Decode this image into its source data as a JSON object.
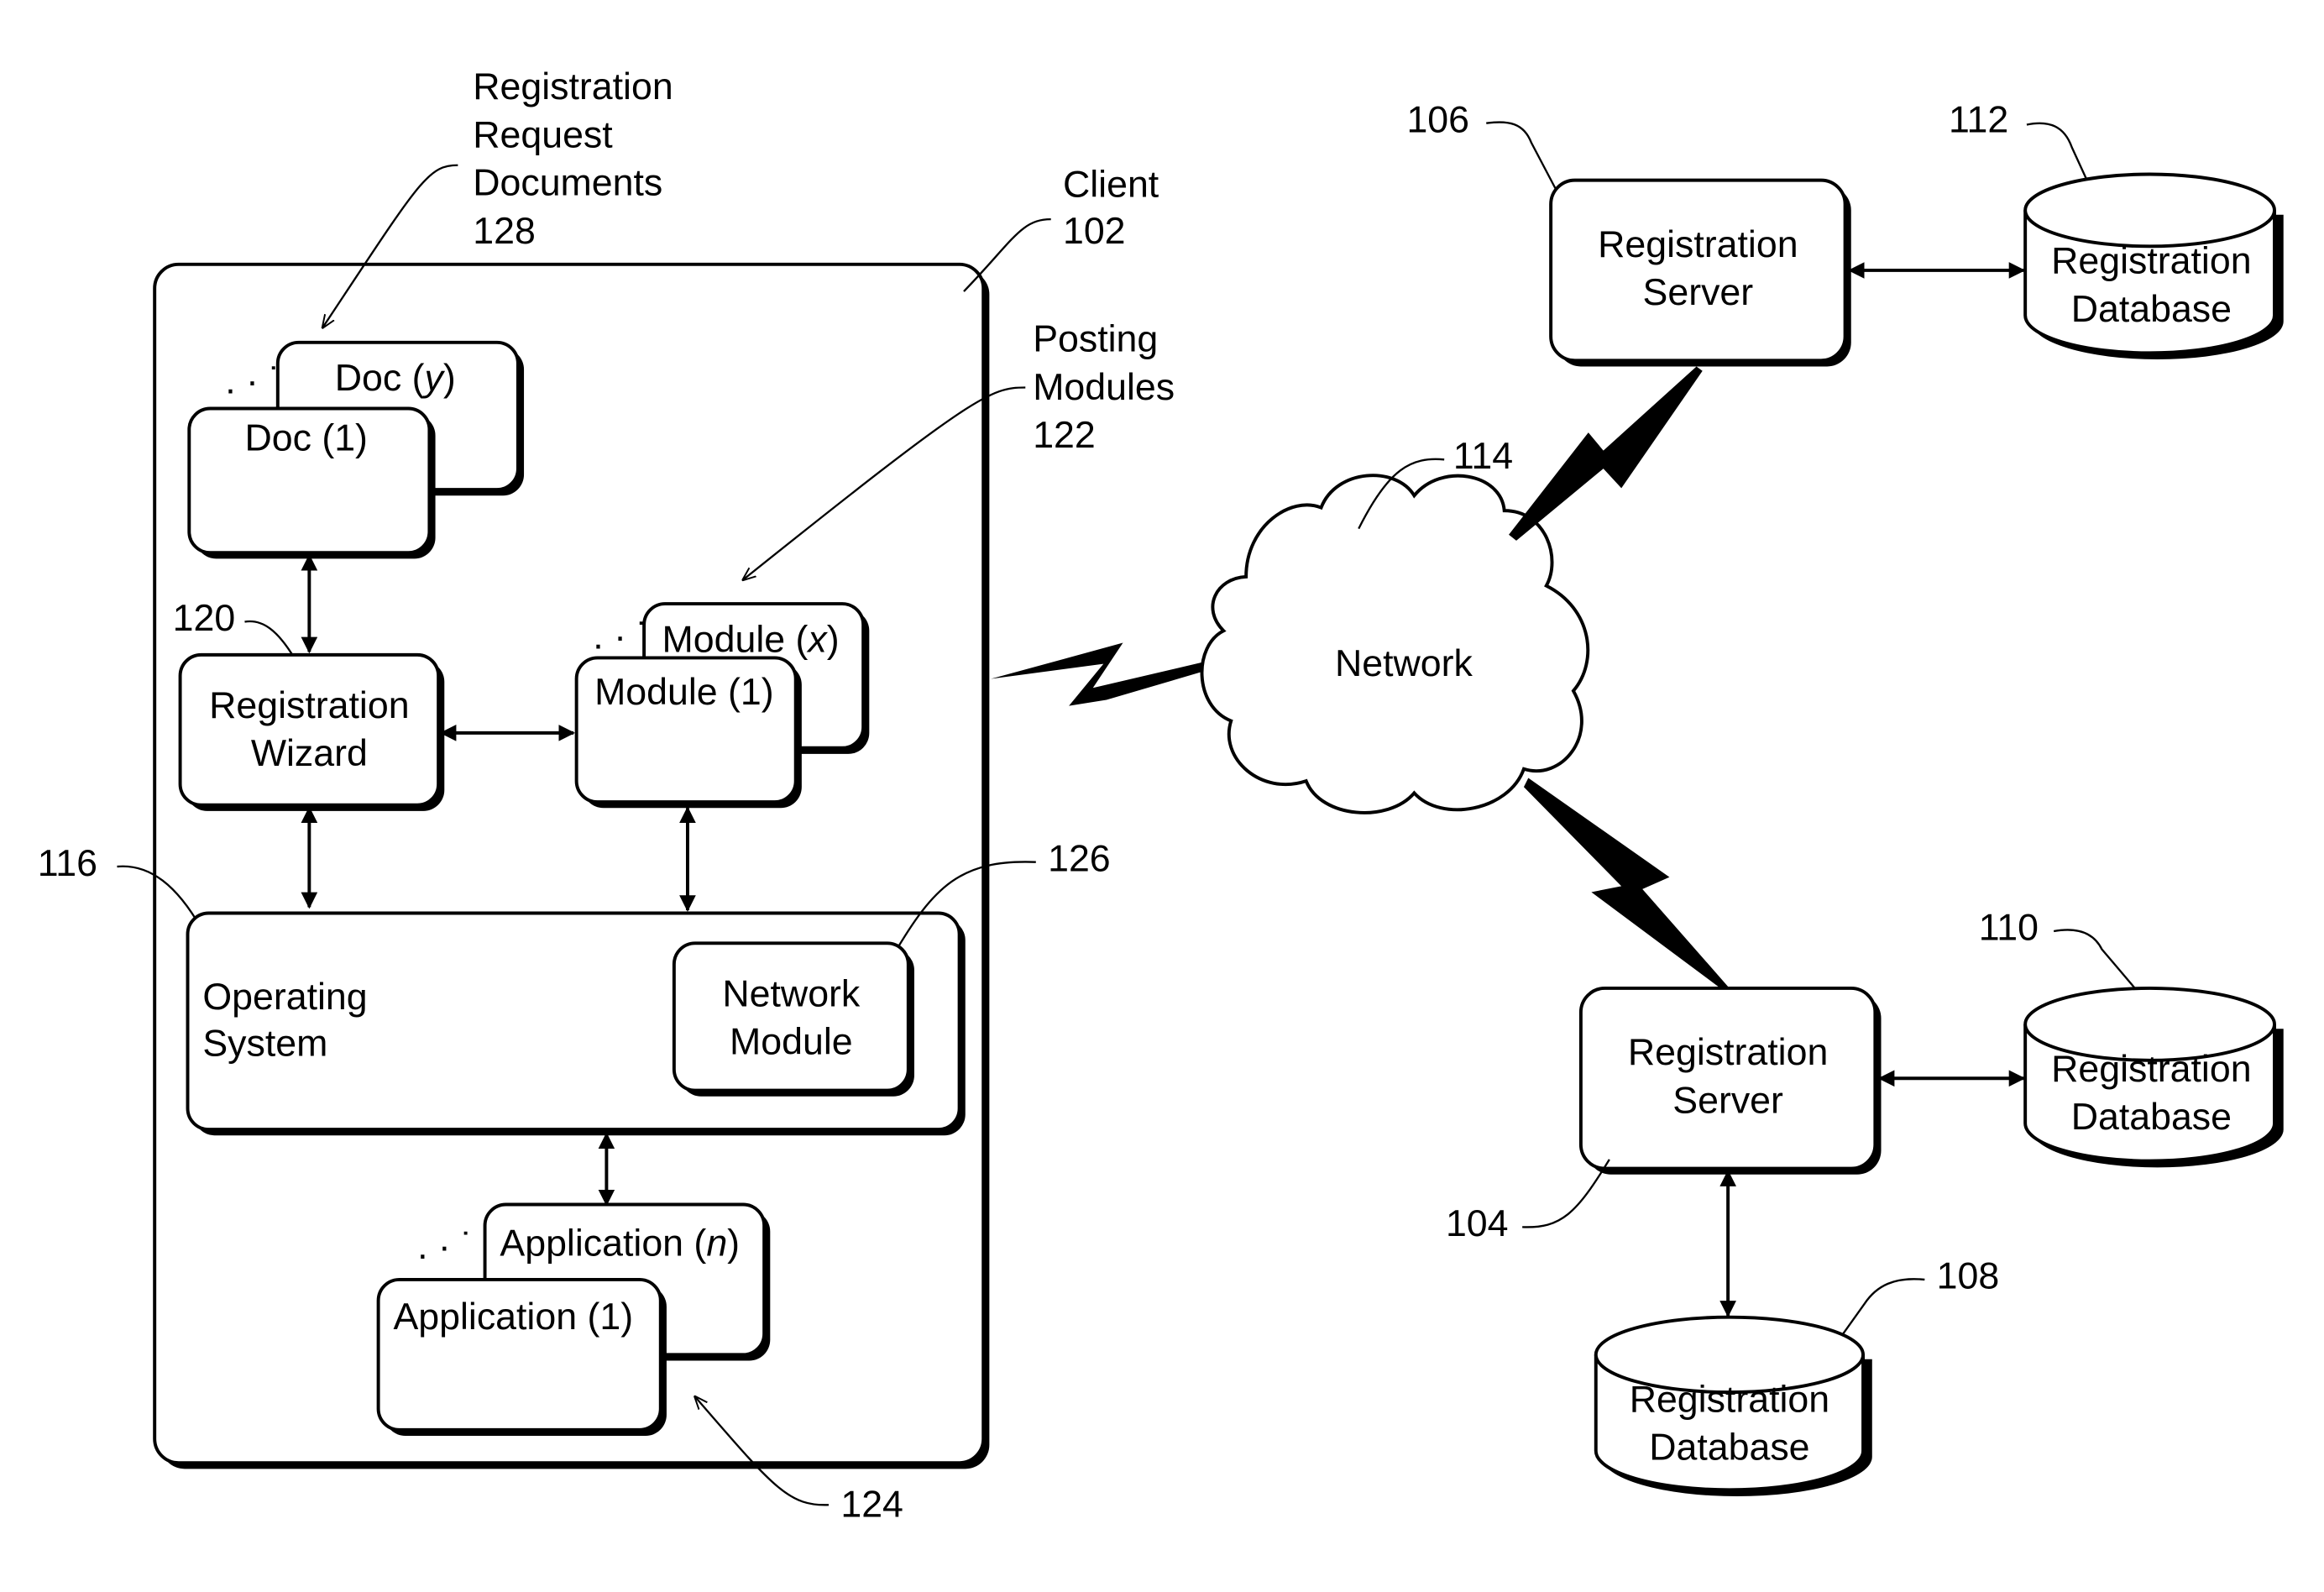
{
  "client": {
    "title": "Client",
    "ref": "102"
  },
  "registration_request_documents": {
    "lines": [
      "Registration",
      "Request",
      "Documents",
      "128"
    ]
  },
  "docs": {
    "back": "Doc (",
    "back_var": "y",
    "front": "Doc (1)"
  },
  "posting_modules": {
    "lines": [
      "Posting",
      "Modules",
      "122"
    ]
  },
  "modules": {
    "back": "Module (",
    "back_var": "x",
    "front": "Module (1)"
  },
  "registration_wizard": {
    "ref": "120",
    "lines": [
      "Registration",
      "Wizard"
    ]
  },
  "operating_system": {
    "ref": "116",
    "lines": [
      "Operating",
      "System"
    ]
  },
  "network_module": {
    "ref": "126",
    "lines": [
      "Network",
      "Module"
    ]
  },
  "applications": {
    "back": "Application (",
    "back_var": "n",
    "front": "Application (1)",
    "ref": "124"
  },
  "network": {
    "label": "Network",
    "ref": "114"
  },
  "server_top": {
    "ref": "106",
    "lines": [
      "Registration",
      "Server"
    ]
  },
  "db_top": {
    "ref": "112",
    "lines": [
      "Registration",
      "Database"
    ]
  },
  "server_bottom": {
    "ref": "104",
    "lines": [
      "Registration",
      "Server"
    ]
  },
  "db_right": {
    "ref": "110",
    "lines": [
      "Registration",
      "Database"
    ]
  },
  "db_bottom": {
    "ref": "108",
    "lines": [
      "Registration",
      "Database"
    ]
  }
}
